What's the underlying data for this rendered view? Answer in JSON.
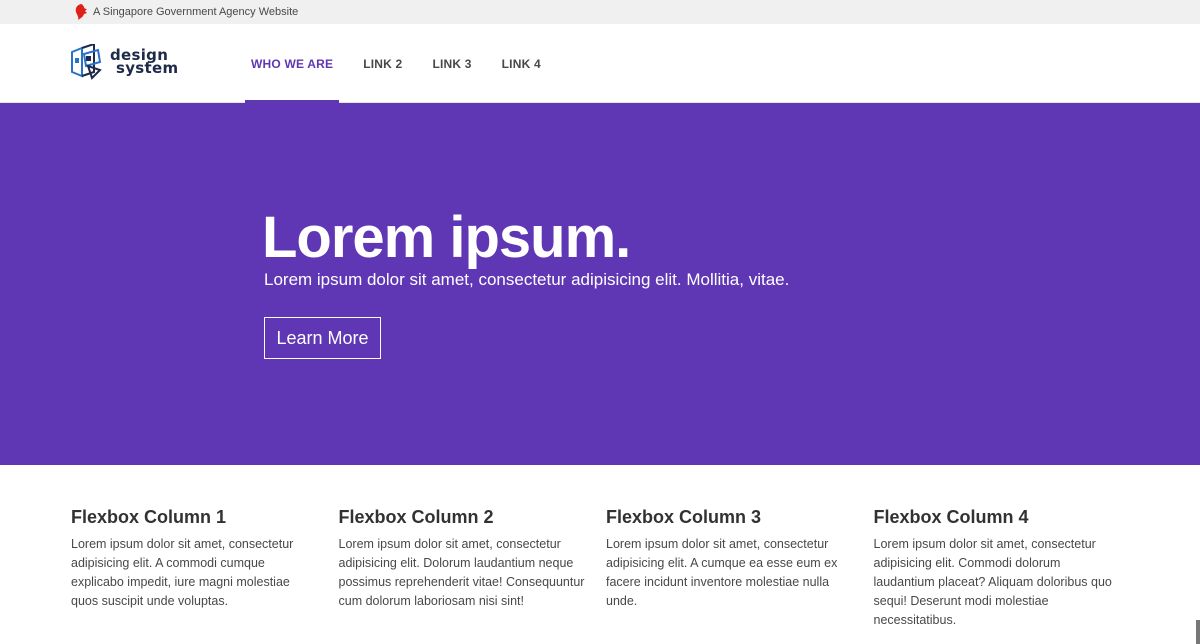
{
  "masthead": {
    "text": "A Singapore Government Agency Website",
    "icon": "lion-head-icon",
    "icon_color": "#e0201b"
  },
  "logo": {
    "line1": "design",
    "line2": "system"
  },
  "nav": {
    "items": [
      {
        "label": "WHO WE ARE",
        "active": true
      },
      {
        "label": "LINK 2",
        "active": false
      },
      {
        "label": "LINK 3",
        "active": false
      },
      {
        "label": "LINK 4",
        "active": false
      }
    ],
    "accent_color": "#5f38b2"
  },
  "hero": {
    "title": "Lorem ipsum.",
    "subtitle": "Lorem ipsum dolor sit amet, consectetur adipisicing elit. Mollitia, vitae.",
    "button_label": "Learn More",
    "background_color": "#5f37b4"
  },
  "columns": [
    {
      "title": "Flexbox Column 1",
      "body": "Lorem ipsum dolor sit amet, consectetur adipisicing elit. A commodi cumque explicabo impedit, iure magni molestiae quos suscipit unde voluptas."
    },
    {
      "title": "Flexbox Column 2",
      "body": "Lorem ipsum dolor sit amet, consectetur adipisicing elit. Dolorum laudantium neque possimus reprehenderit vitae! Consequuntur cum dolorum laboriosam nisi sint!"
    },
    {
      "title": "Flexbox Column 3",
      "body": "Lorem ipsum dolor sit amet, consectetur adipisicing elit. A cumque ea esse eum ex facere incidunt inventore molestiae nulla unde."
    },
    {
      "title": "Flexbox Column 4",
      "body": "Lorem ipsum dolor sit amet, consectetur adipisicing elit. Commodi dolorum laudantium placeat? Aliquam doloribus quo sequi! Deserunt modi molestiae necessitatibus."
    }
  ]
}
